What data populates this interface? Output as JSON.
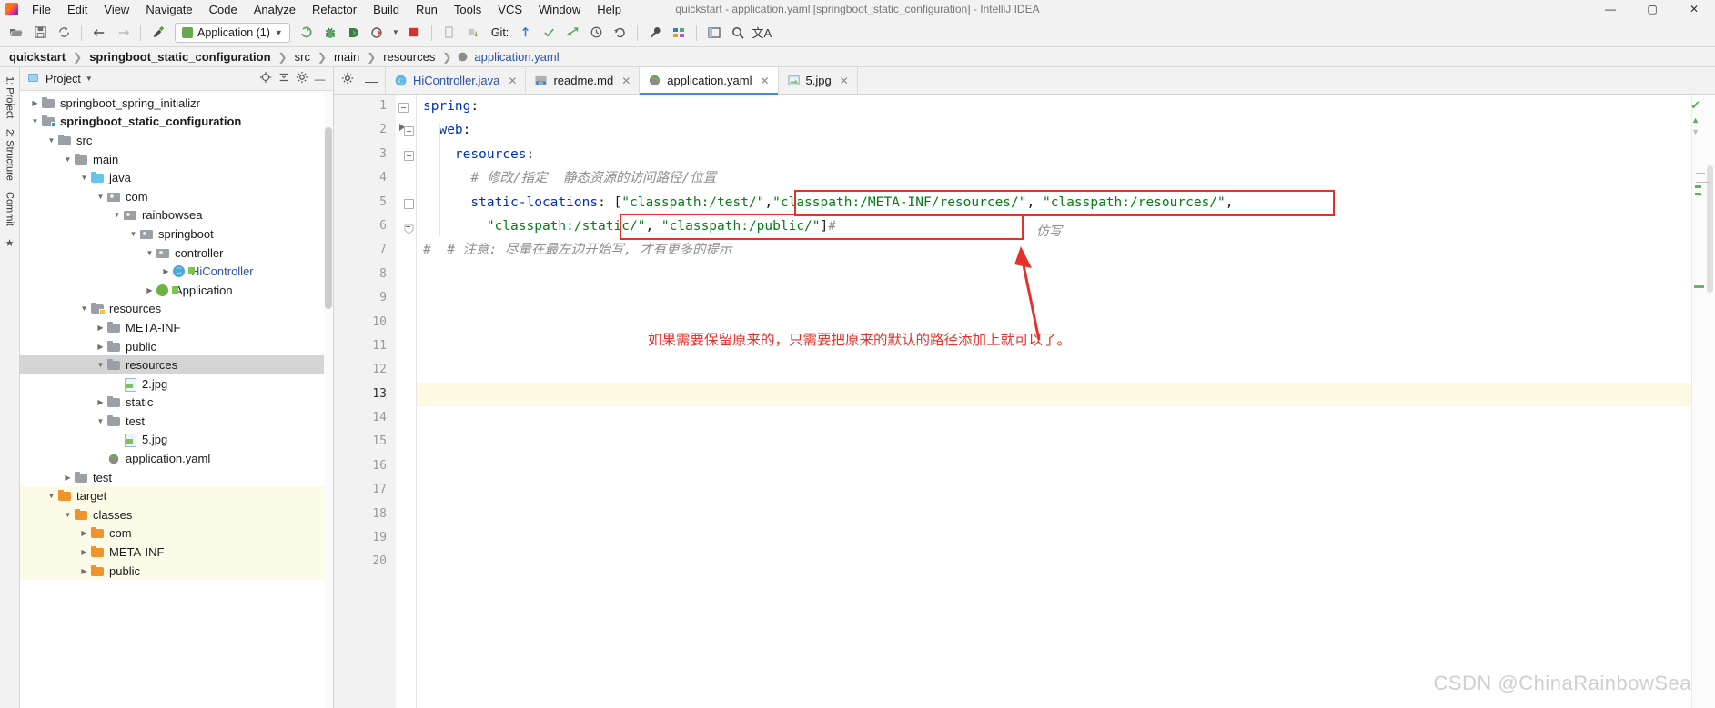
{
  "window": {
    "title": "quickstart - application.yaml [springboot_static_configuration] - IntelliJ IDEA",
    "minimize": "—",
    "maximize": "▢",
    "close": "✕"
  },
  "menu": [
    {
      "label": "File"
    },
    {
      "label": "Edit"
    },
    {
      "label": "View"
    },
    {
      "label": "Navigate"
    },
    {
      "label": "Code"
    },
    {
      "label": "Analyze"
    },
    {
      "label": "Refactor"
    },
    {
      "label": "Build"
    },
    {
      "label": "Run"
    },
    {
      "label": "Tools"
    },
    {
      "label": "VCS"
    },
    {
      "label": "Window"
    },
    {
      "label": "Help"
    }
  ],
  "toolbar": {
    "open_icon": "open-folder-icon",
    "save_icon": "save-icon",
    "sync_icon": "sync-icon",
    "back_icon": "←",
    "forward_icon": "→",
    "build_icon": "build-hammer-icon",
    "run_config": "Application (1)",
    "run_icon": "run-icon",
    "debug_icon": "debug-icon",
    "run_coverage_icon": "coverage-icon",
    "profile_icon": "profile-icon",
    "stop_icon": "stop-icon",
    "device_icon": "device-icon",
    "sync_gradle_icon": "gradle-sync-icon",
    "git_label": "Git:",
    "update_icon": "update-project-icon",
    "commit_icon": "commit-icon",
    "push_icon": "push-icon",
    "history_icon": "history-icon",
    "rollback_icon": "rollback-icon",
    "settings_icon": "wrench-icon",
    "project_structure_icon": "project-structure-icon",
    "layout_icon": "layout-icon",
    "search_icon": "search-icon",
    "translate_icon": "translate-icon"
  },
  "breadcrumb": [
    {
      "label": "quickstart",
      "style": "bold"
    },
    {
      "label": "springboot_static_configuration",
      "style": "bold"
    },
    {
      "label": "src",
      "style": "normal"
    },
    {
      "label": "main",
      "style": "normal"
    },
    {
      "label": "resources",
      "style": "normal"
    },
    {
      "label": "application.yaml",
      "style": "link"
    }
  ],
  "rail": {
    "project": "1: Project",
    "structure": "2: Structure",
    "commit": "Commit",
    "favorites": "Favorites"
  },
  "project_panel": {
    "title": "Project",
    "dropdown_icon": "chevron-down-icon",
    "locate_icon": "locate-icon",
    "collapse_icon": "collapse-all-icon",
    "settings_icon": "gear-icon",
    "hide_icon": "hide-icon"
  },
  "tree": [
    {
      "label": "springboot_spring_initializr",
      "indent": 1,
      "arrow": "▶",
      "icon": "folder-gray",
      "state": "normal"
    },
    {
      "label": "springboot_static_configuration",
      "indent": 1,
      "arrow": "▼",
      "icon": "folder-module",
      "state": "bold"
    },
    {
      "label": "src",
      "indent": 2,
      "arrow": "▼",
      "icon": "folder-gray",
      "state": "normal"
    },
    {
      "label": "main",
      "indent": 3,
      "arrow": "▼",
      "icon": "folder-gray",
      "state": "normal"
    },
    {
      "label": "java",
      "indent": 4,
      "arrow": "▼",
      "icon": "folder-blue",
      "state": "normal"
    },
    {
      "label": "com",
      "indent": 5,
      "arrow": "▼",
      "icon": "package",
      "state": "normal"
    },
    {
      "label": "rainbowsea",
      "indent": 6,
      "arrow": "▼",
      "icon": "package",
      "state": "normal"
    },
    {
      "label": "springboot",
      "indent": 7,
      "arrow": "▼",
      "icon": "package",
      "state": "normal"
    },
    {
      "label": "controller",
      "indent": 8,
      "arrow": "▼",
      "icon": "package",
      "state": "normal"
    },
    {
      "label": "HiController",
      "indent": 9,
      "arrow": "▶",
      "icon": "class",
      "state": "blue"
    },
    {
      "label": "Application",
      "indent": 8,
      "arrow": "▶",
      "icon": "spring",
      "state": "normal"
    },
    {
      "label": "resources",
      "indent": 4,
      "arrow": "▼",
      "icon": "folder-resources",
      "state": "normal"
    },
    {
      "label": "META-INF",
      "indent": 5,
      "arrow": "▶",
      "icon": "folder-gray",
      "state": "normal"
    },
    {
      "label": "public",
      "indent": 5,
      "arrow": "▶",
      "icon": "folder-gray",
      "state": "normal"
    },
    {
      "label": "resources",
      "indent": 5,
      "arrow": "▼",
      "icon": "folder-gray",
      "state": "selected"
    },
    {
      "label": "2.jpg",
      "indent": 6,
      "arrow": "",
      "icon": "image",
      "state": "normal"
    },
    {
      "label": "static",
      "indent": 5,
      "arrow": "▶",
      "icon": "folder-gray",
      "state": "normal"
    },
    {
      "label": "test",
      "indent": 5,
      "arrow": "▼",
      "icon": "folder-gray",
      "state": "normal"
    },
    {
      "label": "5.jpg",
      "indent": 6,
      "arrow": "",
      "icon": "image",
      "state": "normal"
    },
    {
      "label": "application.yaml",
      "indent": 5,
      "arrow": "",
      "icon": "yaml",
      "state": "normal"
    },
    {
      "label": "test",
      "indent": 3,
      "arrow": "▶",
      "icon": "folder-gray",
      "state": "normal"
    },
    {
      "label": "target",
      "indent": 2,
      "arrow": "▼",
      "icon": "folder-orange",
      "state": "target"
    },
    {
      "label": "classes",
      "indent": 3,
      "arrow": "▼",
      "icon": "folder-orange",
      "state": "target"
    },
    {
      "label": "com",
      "indent": 4,
      "arrow": "▶",
      "icon": "folder-orange",
      "state": "target"
    },
    {
      "label": "META-INF",
      "indent": 4,
      "arrow": "▶",
      "icon": "folder-orange",
      "state": "target"
    },
    {
      "label": "public",
      "indent": 4,
      "arrow": "▶",
      "icon": "folder-orange",
      "state": "target"
    }
  ],
  "editor_tabs": [
    {
      "label": "HiController.java",
      "icon": "java-class-icon",
      "active": false,
      "close": "✕"
    },
    {
      "label": "readme.md",
      "icon": "markdown-icon",
      "active": false,
      "close": "✕"
    },
    {
      "label": "application.yaml",
      "icon": "yaml-icon",
      "active": true,
      "close": "✕"
    },
    {
      "label": "5.jpg",
      "icon": "image-icon",
      "active": false,
      "close": "✕"
    }
  ],
  "editor_tools": {
    "settings_icon": "gear-icon",
    "hide_icon": "hide-icon"
  },
  "code": {
    "line_numbers": [
      "1",
      "2",
      "3",
      "4",
      "5",
      "6",
      "7",
      "8",
      "9",
      "10",
      "11",
      "12",
      "13",
      "14",
      "15",
      "16",
      "17",
      "18",
      "19",
      "20"
    ],
    "current_line": "13",
    "lines": [
      {
        "n": 1,
        "segments": [
          {
            "t": "spring",
            "c": "k"
          },
          {
            "t": ":",
            "c": "p"
          }
        ]
      },
      {
        "n": 2,
        "segments": [
          {
            "t": "  web",
            "c": "k"
          },
          {
            "t": ":",
            "c": "p"
          }
        ]
      },
      {
        "n": 3,
        "segments": [
          {
            "t": "    resources",
            "c": "k"
          },
          {
            "t": ":",
            "c": "p"
          }
        ]
      },
      {
        "n": 4,
        "segments": [
          {
            "t": "      # 修改/指定  静态资源的访问路径/位置",
            "c": "cm"
          }
        ]
      },
      {
        "n": 5,
        "segments": [
          {
            "t": "      static-locations",
            "c": "k"
          },
          {
            "t": ": [",
            "c": "p"
          },
          {
            "t": "\"classpath:/test/\"",
            "c": "s"
          },
          {
            "t": ",",
            "c": "p"
          },
          {
            "t": "\"classpath:/META-INF/resources/\"",
            "c": "s"
          },
          {
            "t": ", ",
            "c": "p"
          },
          {
            "t": "\"classpath:/resources/\"",
            "c": "s"
          },
          {
            "t": ",",
            "c": "p"
          }
        ]
      },
      {
        "n": 6,
        "segments": [
          {
            "t": "        ",
            "c": "p"
          },
          {
            "t": "\"classpath:/static/\"",
            "c": "s"
          },
          {
            "t": ", ",
            "c": "p"
          },
          {
            "t": "\"classpath:/public/\"",
            "c": "s"
          },
          {
            "t": "]",
            "c": "p"
          },
          {
            "t": "#",
            "c": "cm"
          }
        ]
      },
      {
        "n": 7,
        "segments": [
          {
            "t": "#  # 注意: 尽量在最左边开始写, 才有更多的提示",
            "c": "cm"
          }
        ]
      },
      {
        "n": 8,
        "segments": []
      },
      {
        "n": 9,
        "segments": []
      },
      {
        "n": 10,
        "segments": []
      },
      {
        "n": 11,
        "segments": []
      },
      {
        "n": 12,
        "segments": []
      },
      {
        "n": 13,
        "segments": []
      },
      {
        "n": 14,
        "segments": []
      },
      {
        "n": 15,
        "segments": []
      },
      {
        "n": 16,
        "segments": []
      },
      {
        "n": 17,
        "segments": []
      },
      {
        "n": 18,
        "segments": []
      },
      {
        "n": 19,
        "segments": []
      },
      {
        "n": 20,
        "segments": []
      }
    ]
  },
  "annotations": {
    "fangxie": "仿写",
    "note": "如果需要保留原来的，只需要把原来的默认的路径添加上就可以了。",
    "arrow_color": "#e4322b",
    "box_color": "#e4322b"
  },
  "watermark": "CSDN @ChinaRainbowSea",
  "colors": {
    "accent": "#3c8de0",
    "string": "#067d17",
    "keyword": "#0033b3",
    "comment": "#8c8c8c",
    "annotation_red": "#e4322b",
    "selected_row": "#d4d4d4",
    "target_row": "#fbfbe8"
  }
}
